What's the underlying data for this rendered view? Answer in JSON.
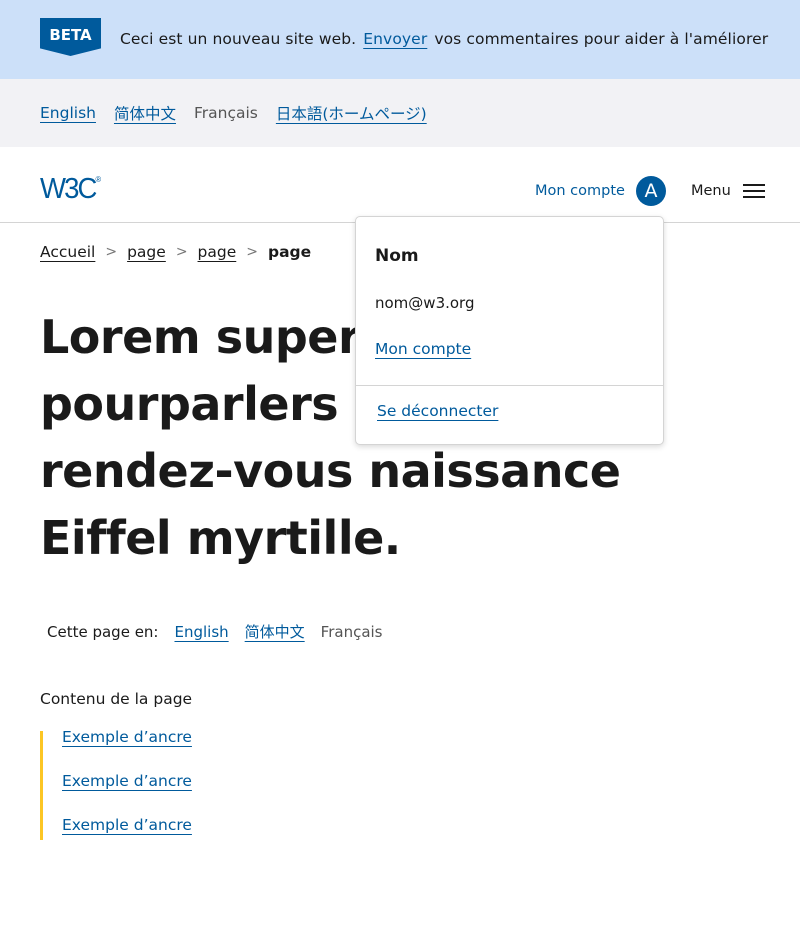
{
  "banner": {
    "badge": "BETA",
    "text_before": "Ceci est un nouveau site web.",
    "link": "Envoyer",
    "text_after": "vos commentaires pour aider à l'améliorer"
  },
  "language_bar": {
    "items": [
      {
        "label": "English",
        "current": false
      },
      {
        "label": "简体中文",
        "current": false
      },
      {
        "label": "Français",
        "current": true
      },
      {
        "label": "日本語(ホームページ)",
        "current": false
      }
    ]
  },
  "header": {
    "logo": "W3C",
    "logo_mark": "®",
    "account_label": "Mon compte",
    "avatar_initial": "A",
    "menu_label": "Menu"
  },
  "breadcrumb": {
    "items": [
      "Accueil",
      "page",
      "page"
    ],
    "separator": ">",
    "current": "page"
  },
  "title": "Lorem superpositions pourparlers rendez-vous naissance Eiffel myrtille.",
  "title_lines": [
    "Lorem superp",
    "pourparlers r",
    "rendez-vous naissance",
    "Eiffel myrtille."
  ],
  "page_languages": {
    "label": "Cette page en:",
    "items": [
      {
        "label": "English",
        "current": false
      },
      {
        "label": "简体中文",
        "current": false
      },
      {
        "label": "Français",
        "current": true
      }
    ]
  },
  "toc": {
    "title": "Contenu de la page",
    "items": [
      "Exemple d’ancre",
      "Exemple d’ancre",
      "Exemple d’ancre"
    ]
  },
  "account_dropdown": {
    "name": "Nom",
    "email": "nom@w3.org",
    "account_link": "Mon compte",
    "logout": "Se déconnecter"
  },
  "colors": {
    "brand": "#005a9c",
    "banner_bg": "#cce0f9",
    "lang_bar_bg": "#f2f2f5",
    "toc_accent": "#fcc624"
  }
}
